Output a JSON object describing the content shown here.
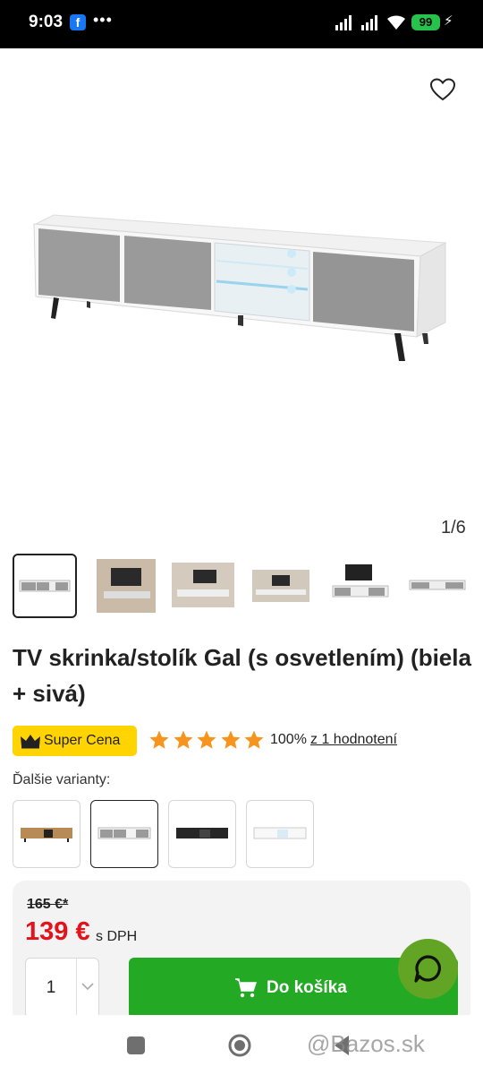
{
  "status_bar": {
    "time": "9:03",
    "battery_level": "99",
    "icons": [
      "facebook-icon",
      "more-dots-icon",
      "signal-icon",
      "wifi-icon",
      "battery-icon",
      "charging-icon"
    ]
  },
  "gallery": {
    "counter": "1/6",
    "favorite_icon": "heart-icon",
    "thumbnail_count": 6,
    "active_thumbnail": 1
  },
  "product": {
    "title": "TV skrinka/stolík Gal (s osvetlením) (biela + sivá)"
  },
  "badge": {
    "label": "Super Cena",
    "icon": "crown-icon",
    "color": "#ffd400"
  },
  "rating": {
    "stars": 5,
    "max_stars": 5,
    "percent": "100%",
    "count_link": "z 1 hodnotení",
    "star_color": "#f7941d"
  },
  "variants": {
    "label": "Ďalšie varianty:",
    "items": [
      "variant-oak",
      "variant-white-gray",
      "variant-black",
      "variant-white"
    ],
    "selected": 1
  },
  "purchase": {
    "old_price": "165 €*",
    "price": "139 €",
    "vat_label": "s DPH",
    "quantity": "1",
    "cart_button": "Do košíka",
    "price_color": "#e3131b",
    "button_color": "#23a923",
    "chat_color": "#62a524"
  },
  "nav_bar": {
    "icons": [
      "recent-apps-icon",
      "home-icon",
      "back-icon"
    ]
  },
  "watermark": "@Bazos.sk"
}
